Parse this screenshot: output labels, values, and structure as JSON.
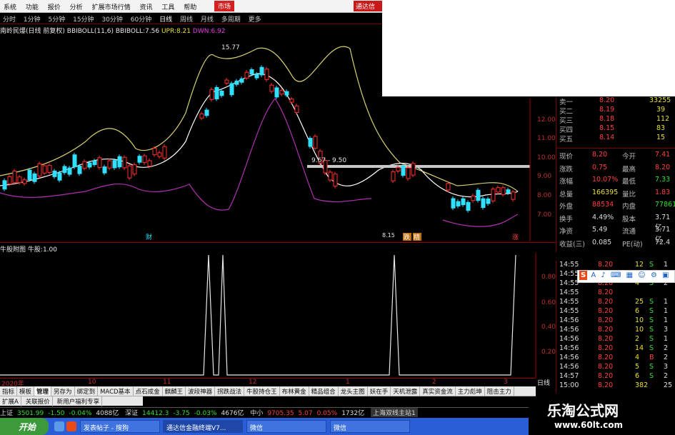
{
  "menu": {
    "items": [
      "系统",
      "功能",
      "报价",
      "分析",
      "扩展市场行情",
      "资讯",
      "工具",
      "帮助"
    ],
    "market": "市场",
    "brand": "通达信"
  },
  "periods": {
    "items": [
      "分时",
      "1分钟",
      "5分钟",
      "15分钟",
      "30分钟",
      "60分钟",
      "日线",
      "周线",
      "月线",
      "多周期",
      "更多"
    ],
    "active": "日线"
  },
  "main_chart": {
    "stock": "南岭民爆(日线 前复权)",
    "indicator": "BBIBOLL(11,6)",
    "bbiboll_label": "BBIBOLL:",
    "bbiboll": "7.56",
    "upr_label": "UPR:",
    "upr": "8.21",
    "dwn_label": "DWN:",
    "dwn": "6.92",
    "high_label": "15.77",
    "range_label": "9.67 - 9.50",
    "low_label": "8.15",
    "markers": [
      "财",
      "跌",
      "精",
      "涨"
    ],
    "price_axis": [
      "12.00",
      "11.00",
      "10.00",
      "9.00",
      "8.00",
      "7.00"
    ]
  },
  "sub_chart": {
    "name": "牛股附图",
    "value_label": "牛股:",
    "value": "1.00",
    "axis": [
      "0.80",
      "0.60",
      "0.40",
      "0.20"
    ]
  },
  "quote": {
    "top_line": [
      "卖一",
      "8.20",
      "33255"
    ],
    "bids": [
      {
        "label": "买二",
        "price": "8.19",
        "vol": "39"
      },
      {
        "label": "买三",
        "price": "8.18",
        "vol": "112"
      },
      {
        "label": "买四",
        "price": "8.15",
        "vol": "83"
      },
      {
        "label": "买五",
        "price": "8.14",
        "vol": "15"
      }
    ],
    "stats": [
      {
        "l1": "现价",
        "v1": "8.20",
        "l2": "今开",
        "v2": "7.41"
      },
      {
        "l1": "涨跌",
        "v1": "0.75",
        "l2": "最高",
        "v2": "8.20"
      },
      {
        "l1": "涨幅",
        "v1": "10.07%",
        "l2": "最低",
        "v2": "7.33"
      },
      {
        "l1": "总量",
        "v1": "166395",
        "l2": "量比",
        "v2": "1.83"
      },
      {
        "l1": "外盘",
        "v1": "88534",
        "l2": "内盘",
        "v2": "77861"
      },
      {
        "l1": "换手",
        "v1": "4.49%",
        "l2": "股本",
        "v2": "3.71亿"
      },
      {
        "l1": "净资",
        "v1": "5.49",
        "l2": "流通",
        "v2": "3.71亿"
      },
      {
        "l1": "收益(三)",
        "v1": "0.085",
        "l2": "PE(动)",
        "v2": "72.4"
      }
    ]
  },
  "ticks": [
    {
      "t": "14:55",
      "p": "8.20",
      "v": "12",
      "s": "S",
      "n": "1"
    },
    {
      "t": "14:55",
      "p": "8.20",
      "v": "14",
      "s": "S",
      "n": "1"
    },
    {
      "t": "14:55",
      "p": "8.20",
      "v": "4",
      "s": "S",
      "n": "2"
    },
    {
      "t": "14:55",
      "p": "8.20",
      "v": "",
      "s": "",
      "n": ""
    },
    {
      "t": "14:55",
      "p": "8.20",
      "v": "25",
      "s": "S",
      "n": "1"
    },
    {
      "t": "14:55",
      "p": "8.20",
      "v": "6",
      "s": "S",
      "n": "1"
    },
    {
      "t": "14:56",
      "p": "8.20",
      "v": "10",
      "s": "S",
      "n": "1"
    },
    {
      "t": "14:56",
      "p": "8.20",
      "v": "10",
      "s": "S",
      "n": "3"
    },
    {
      "t": "14:56",
      "p": "8.20",
      "v": "2",
      "s": "S",
      "n": "1"
    },
    {
      "t": "14:56",
      "p": "8.20",
      "v": "14",
      "s": "S",
      "n": "2"
    },
    {
      "t": "14:56",
      "p": "8.20",
      "v": "4",
      "s": "B",
      "n": "2"
    },
    {
      "t": "14:56",
      "p": "8.20",
      "v": "5",
      "s": "S",
      "n": "3"
    },
    {
      "t": "14:57",
      "p": "8.20",
      "v": "6",
      "s": "S",
      "n": "2"
    },
    {
      "t": "15:00",
      "p": "8.20",
      "v": "382",
      "s": "",
      "n": "25"
    }
  ],
  "sogou": {
    "items": [
      "S",
      "A",
      "♪",
      "⌨",
      "▦",
      "☺",
      "⚙",
      "▣"
    ]
  },
  "dates": [
    "2020年",
    "10",
    "11",
    "12",
    "1",
    "2",
    "3"
  ],
  "date_tab": "日线",
  "tabs": [
    "指标",
    "模板",
    "管理",
    "另存为",
    "绑定到",
    "MACD基本",
    "点石成金",
    "麒麟王",
    "波段神器",
    "拐跌战法",
    "牛股持仓王",
    "布林黄金",
    "精品组合",
    "龙头主图",
    "妖在手",
    "天机泄露",
    "真实资金流",
    "主力彪坤",
    "阻击主力"
  ],
  "active_tab": "管理",
  "tabs2": [
    "扩展A",
    "关联报价",
    "新用户福利专享"
  ],
  "status": {
    "sh_label": "上证",
    "sh_val": "3501.99",
    "sh_chg": "-1.50",
    "sh_pct": "-0.04%",
    "sh_amt": "4088亿",
    "sz_label": "深证",
    "sz_val": "14412.3",
    "sz_chg": "-3.75",
    "sz_pct": "-0.03%",
    "sz_amt": "4676亿",
    "zx_label": "中小",
    "zx_val": "9705.35",
    "zx_chg": "5.07",
    "zx_pct": "0.05%",
    "zx_amt": "1732亿",
    "server": "上海双线主站1"
  },
  "taskbar": {
    "start": "开始",
    "tasks": [
      "发表帖子 - 搜狗",
      "通达信金融终端V7...",
      "微信",
      "微信"
    ]
  },
  "watermark": {
    "text": "乐淘公式网",
    "url": "www.60lt.com"
  },
  "colors": {
    "up": "#ff3030",
    "down": "#30e0ff",
    "upper_band": "#d8d070",
    "lower_band": "#b030b0",
    "mid_band": "#ffffff"
  }
}
